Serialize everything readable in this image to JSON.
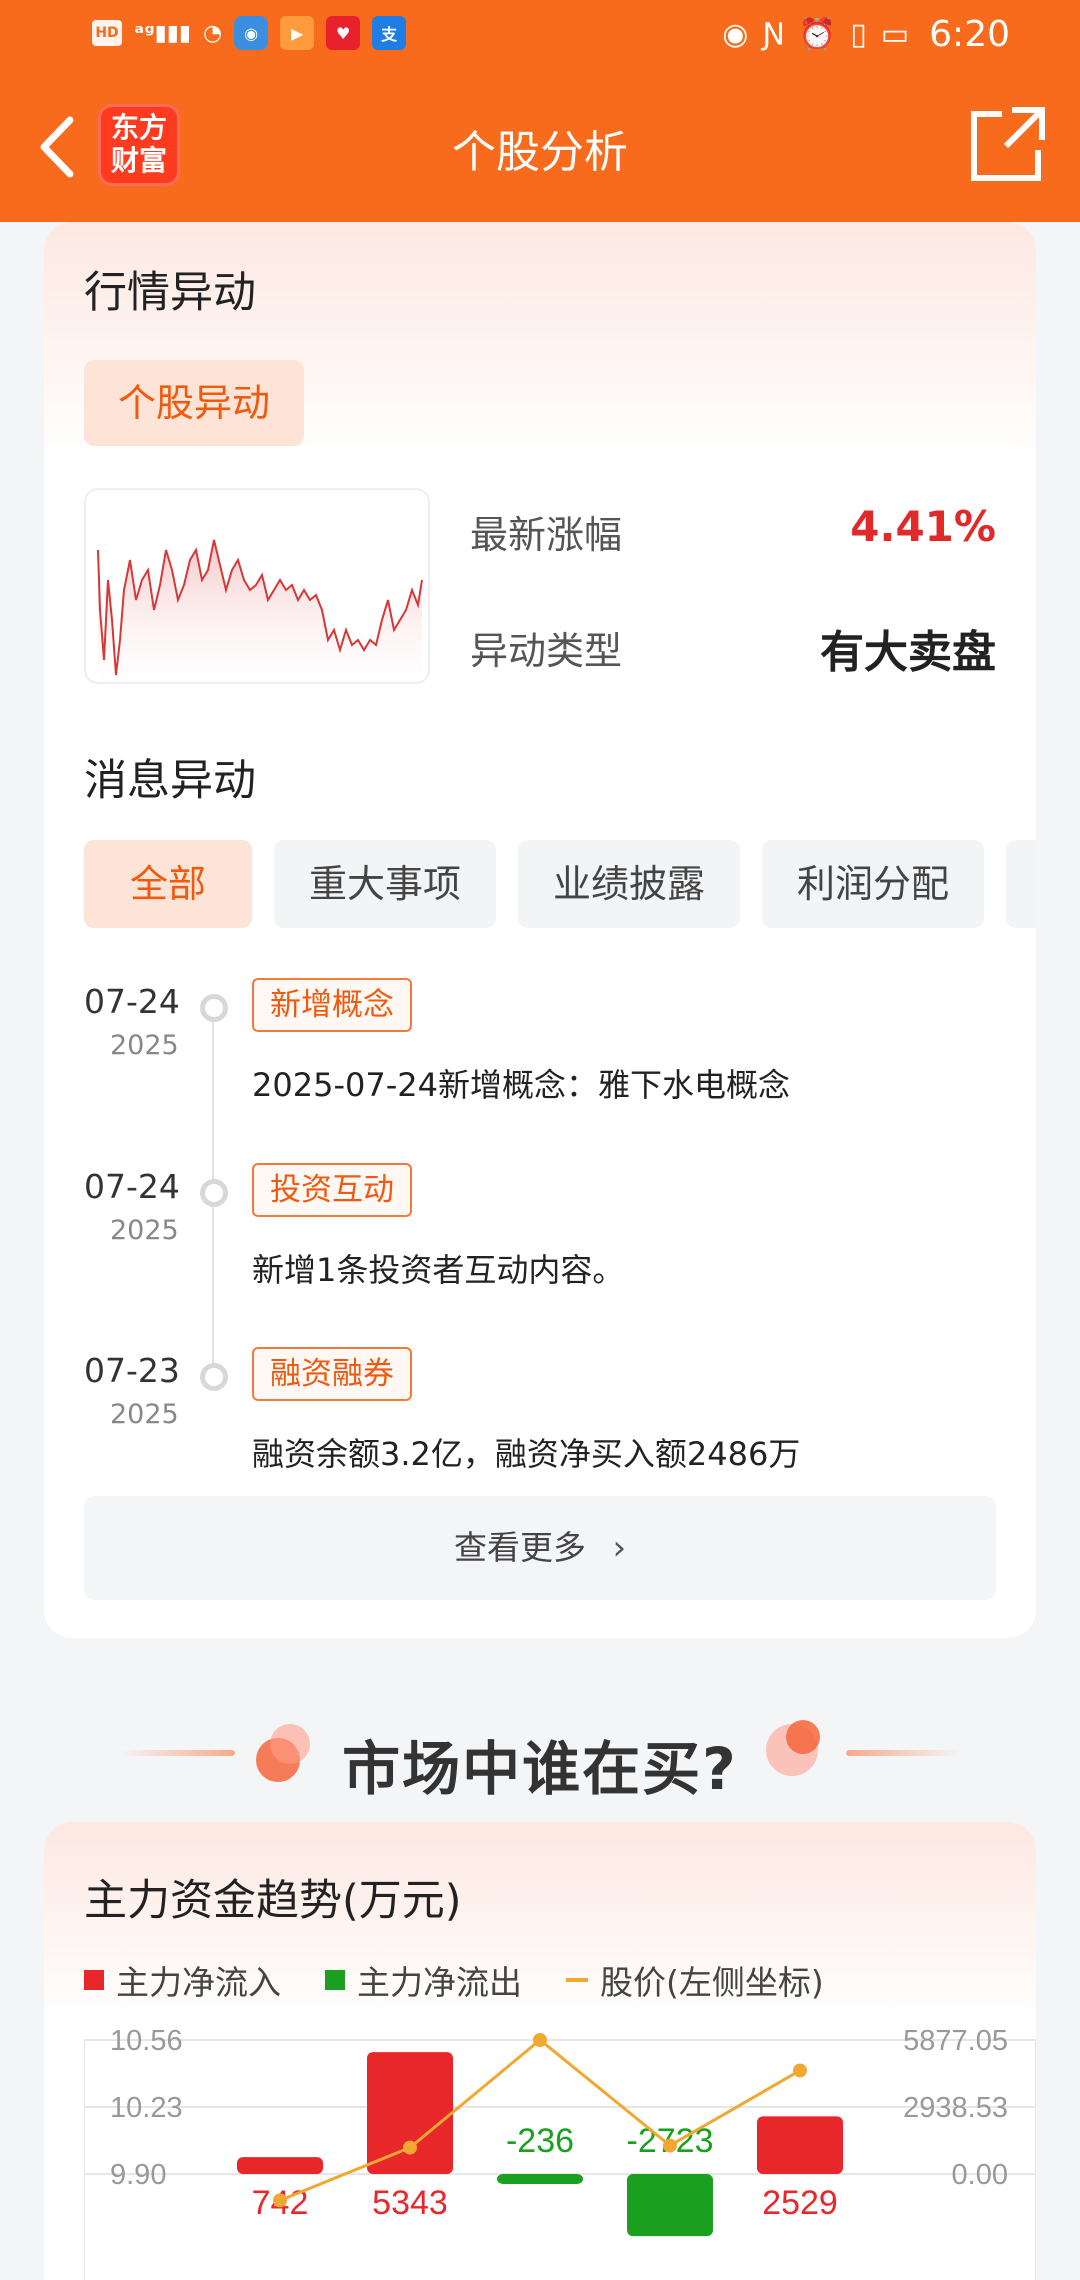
{
  "status_bar": {
    "left_icons": [
      "hd-icon",
      "5g-signal-icon",
      "wifi-icon",
      "browser-icon",
      "video-icon",
      "app-icon",
      "alipay-icon"
    ],
    "time": "6:20"
  },
  "nav": {
    "logo_text": "东方\n财富",
    "title": "个股分析"
  },
  "market_anomaly": {
    "title": "行情异动",
    "chip": "个股异动",
    "latest_change_label": "最新涨幅",
    "latest_change_value": "4.41%",
    "anomaly_type_label": "异动类型",
    "anomaly_type_value": "有大卖盘"
  },
  "news_anomaly": {
    "title": "消息异动",
    "tabs": [
      "全部",
      "重大事项",
      "业绩披露",
      "利润分配"
    ],
    "items": [
      {
        "date": "07-24",
        "year": "2025",
        "tag": "新增概念",
        "text": "2025-07-24新增概念：雅下水电概念"
      },
      {
        "date": "07-24",
        "year": "2025",
        "tag": "投资互动",
        "text": "新增1条投资者互动内容。"
      },
      {
        "date": "07-23",
        "year": "2025",
        "tag": "融资融券",
        "text": "融资余额3.2亿，融资净买入额2486万"
      }
    ],
    "more_label": "查看更多"
  },
  "banner": {
    "title": "市场中谁在买?"
  },
  "fund_trend": {
    "title": "主力资金趋势(万元)",
    "legend": {
      "inflow": "主力净流入",
      "outflow": "主力净流出",
      "price": "股价(左侧坐标)"
    },
    "colors": {
      "inflow": "#e8272b",
      "outflow": "#1aa01e",
      "price": "#f0a830"
    }
  },
  "chart_data": {
    "type": "bar",
    "title": "主力资金趋势(万元)",
    "left_axis_ticks": [
      "10.56",
      "10.23",
      "9.90"
    ],
    "right_axis_ticks": [
      "5877.05",
      "2938.53",
      "0.00"
    ],
    "left_ylim": [
      9.9,
      10.56
    ],
    "right_ylim": [
      0,
      5877.05
    ],
    "series": [
      {
        "name": "主力净流入",
        "values": [
          742,
          5343,
          null,
          null,
          2529
        ]
      },
      {
        "name": "主力净流出",
        "values": [
          null,
          null,
          -236,
          -2723,
          null
        ]
      }
    ],
    "bar_labels": [
      "742",
      "5343",
      "-236",
      "-2723",
      "2529"
    ],
    "price_series_name": "股价(左侧坐标)",
    "price": [
      9.77,
      10.03,
      10.56,
      10.04,
      10.41
    ]
  }
}
